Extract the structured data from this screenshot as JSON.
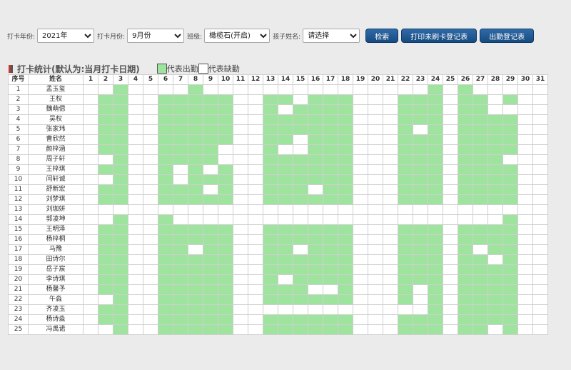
{
  "filters": {
    "year_label": "打卡年份:",
    "year_value": "2021年",
    "month_label": "打卡月份:",
    "month_value": "9月份",
    "class_label": "班级:",
    "class_value": "橄榄石(开启)",
    "child_label": "孩子姓名:",
    "child_value": "请选择"
  },
  "buttons": {
    "search": "检索",
    "print_missing": "打印未刷卡登记表",
    "attendance": "出勤登记表"
  },
  "section": {
    "title": "打卡统计(默认为:当月打卡日期)",
    "legend_present": "代表出勤",
    "legend_absent": "代表缺勤"
  },
  "colors": {
    "present": "#9ee49e",
    "absent": "#ffffff",
    "button": "#1f5a96"
  },
  "table": {
    "header_index": "序号",
    "header_name": "姓名",
    "days": [
      "1",
      "2",
      "3",
      "4",
      "5",
      "6",
      "7",
      "8",
      "9",
      "10",
      "11",
      "12",
      "13",
      "14",
      "15",
      "16",
      "17",
      "18",
      "19",
      "20",
      "21",
      "22",
      "23",
      "24",
      "25",
      "26",
      "27",
      "28",
      "29",
      "30",
      "31"
    ],
    "rows": [
      {
        "index": "1",
        "name": "孟玉玺",
        "present": [
          3,
          8,
          24,
          26
        ]
      },
      {
        "index": "2",
        "name": "王权",
        "present": [
          2,
          3,
          6,
          7,
          8,
          9,
          10,
          13,
          14,
          16,
          17,
          18,
          22,
          23,
          24,
          26,
          27,
          29
        ]
      },
      {
        "index": "3",
        "name": "魏萌偲",
        "present": [
          2,
          3,
          6,
          7,
          8,
          9,
          10,
          13,
          15,
          16,
          17,
          18,
          22,
          23,
          24,
          26,
          27
        ]
      },
      {
        "index": "4",
        "name": "吴权",
        "present": [
          2,
          3,
          6,
          7,
          8,
          9,
          10,
          13,
          14,
          15,
          16,
          17,
          18,
          22,
          23,
          24,
          26,
          27,
          28,
          29
        ]
      },
      {
        "index": "5",
        "name": "张家玮",
        "present": [
          2,
          3,
          6,
          7,
          8,
          9,
          10,
          13,
          14,
          15,
          16,
          17,
          18,
          22,
          24,
          26,
          27,
          28,
          29
        ]
      },
      {
        "index": "6",
        "name": "曹欣然",
        "present": [
          2,
          3,
          6,
          7,
          8,
          9,
          10,
          13,
          14,
          16,
          17,
          18,
          22,
          23,
          24,
          26,
          27,
          28,
          29
        ]
      },
      {
        "index": "7",
        "name": "颜梓涵",
        "present": [
          2,
          3,
          6,
          7,
          8,
          9,
          13,
          16,
          17,
          18,
          22,
          23,
          24,
          26,
          27,
          28,
          29
        ]
      },
      {
        "index": "8",
        "name": "周子轩",
        "present": [
          3,
          6,
          7,
          8,
          9,
          13,
          14,
          15,
          16,
          17,
          18,
          22,
          23,
          24,
          26,
          27,
          28
        ]
      },
      {
        "index": "9",
        "name": "王梓琪",
        "present": [
          2,
          3,
          6,
          8,
          10,
          13,
          14,
          15,
          16,
          17,
          18,
          22,
          23,
          24,
          26,
          27,
          28,
          29
        ]
      },
      {
        "index": "10",
        "name": "闫轩诚",
        "present": [
          3,
          6,
          8,
          9,
          10,
          13,
          14,
          15,
          16,
          17,
          18,
          22,
          23,
          24,
          26,
          27,
          28,
          29
        ]
      },
      {
        "index": "11",
        "name": "舒新宏",
        "present": [
          2,
          3,
          6,
          7,
          8,
          10,
          13,
          14,
          15,
          17,
          18,
          22,
          23,
          24,
          26,
          27,
          28,
          29
        ]
      },
      {
        "index": "12",
        "name": "刘梦琪",
        "present": [
          2,
          3,
          6,
          7,
          8,
          9,
          10,
          13,
          14,
          15,
          16,
          17,
          18,
          22,
          23,
          24,
          26,
          27,
          28,
          29
        ]
      },
      {
        "index": "13",
        "name": "刘珈妍",
        "present": []
      },
      {
        "index": "14",
        "name": "郭凌坤",
        "present": [
          3,
          6,
          29
        ]
      },
      {
        "index": "15",
        "name": "王明泽",
        "present": [
          2,
          3,
          6,
          7,
          8,
          9,
          10,
          13,
          14,
          15,
          16,
          17,
          18,
          22,
          23,
          24,
          26,
          27,
          28,
          29
        ]
      },
      {
        "index": "16",
        "name": "杨梓桐",
        "present": [
          2,
          3,
          6,
          7,
          8,
          9,
          10,
          13,
          14,
          15,
          16,
          17,
          18,
          22,
          23,
          24,
          26,
          27,
          28,
          29
        ]
      },
      {
        "index": "17",
        "name": "马豫",
        "present": [
          2,
          3,
          6,
          7,
          9,
          10,
          13,
          14,
          16,
          17,
          18,
          22,
          23,
          24,
          26,
          28,
          29
        ]
      },
      {
        "index": "18",
        "name": "田诗尔",
        "present": [
          2,
          3,
          6,
          7,
          8,
          9,
          10,
          13,
          14,
          15,
          16,
          17,
          18,
          22,
          23,
          24,
          26,
          27,
          29
        ]
      },
      {
        "index": "19",
        "name": "岳子宸",
        "present": [
          2,
          3,
          6,
          7,
          8,
          9,
          10,
          13,
          14,
          15,
          16,
          17,
          18,
          22,
          23,
          24,
          26,
          27,
          28,
          29
        ]
      },
      {
        "index": "20",
        "name": "李诗琪",
        "present": [
          2,
          3,
          6,
          7,
          8,
          9,
          10,
          13,
          15,
          16,
          17,
          18,
          22,
          23,
          24,
          26,
          27,
          28,
          29
        ]
      },
      {
        "index": "21",
        "name": "杨馨予",
        "present": [
          2,
          3,
          6,
          7,
          8,
          9,
          10,
          13,
          14,
          15,
          18,
          22,
          24,
          26,
          27,
          28,
          29
        ]
      },
      {
        "index": "22",
        "name": "午淼",
        "present": [
          3,
          6,
          7,
          8,
          9,
          10,
          13,
          14,
          15,
          16,
          17,
          18,
          22,
          24,
          26,
          27,
          28,
          29
        ]
      },
      {
        "index": "23",
        "name": "齐凌玉",
        "present": [
          2,
          3,
          6,
          7,
          8,
          9,
          10,
          24,
          26,
          27,
          28,
          29
        ]
      },
      {
        "index": "24",
        "name": "杨诗淼",
        "present": [
          2,
          3,
          6,
          7,
          8,
          9,
          10,
          13,
          14,
          15,
          16,
          17,
          18,
          22,
          23,
          24,
          26,
          27,
          28,
          29
        ]
      },
      {
        "index": "25",
        "name": "冯禹诺",
        "present": [
          3,
          6,
          7,
          8,
          9,
          10,
          13,
          14,
          15,
          16,
          17,
          18,
          22,
          23,
          24,
          26,
          27,
          29
        ]
      }
    ]
  }
}
